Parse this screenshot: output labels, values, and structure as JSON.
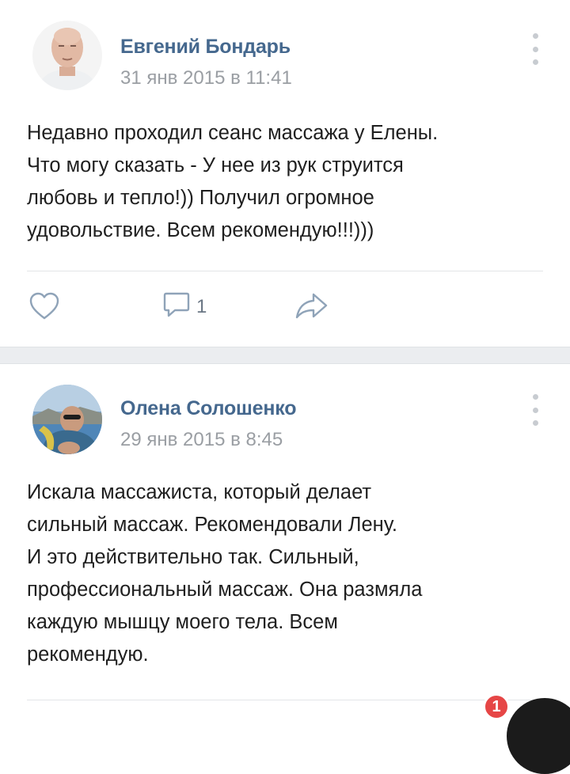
{
  "posts": [
    {
      "author": "Евгений Бондарь",
      "date": "31 янв 2015 в 11:41",
      "text_lines": [
        "Недавно проходил сеанс массажа у Елены.",
        "Что могу сказать - У нее из рук струится",
        "любовь и тепло!)) Получил огромное",
        "удовольствие. Всем рекомендую!!!)))"
      ],
      "comment_count": "1"
    },
    {
      "author": "Олена Солошенко",
      "date": "29 янв 2015 в 8:45",
      "text_lines": [
        "Искала массажиста, который делает",
        "сильный массаж. Рекомендовали Лену.",
        "И это действительно так. Сильный,",
        "профессиональный массаж. Она размяла",
        "каждую мышцу моего тела. Всем",
        "рекомендую."
      ]
    }
  ],
  "notification": {
    "badge": "1"
  },
  "icons": {
    "like": "heart-icon",
    "comment": "comment-icon",
    "share": "share-arrow-icon",
    "menu": "more-vertical-icon"
  },
  "colors": {
    "author": "#45688e",
    "date": "#9a9ea3",
    "icon": "#8fa3b8",
    "separator": "#ebedf0",
    "badge": "#e64646"
  }
}
